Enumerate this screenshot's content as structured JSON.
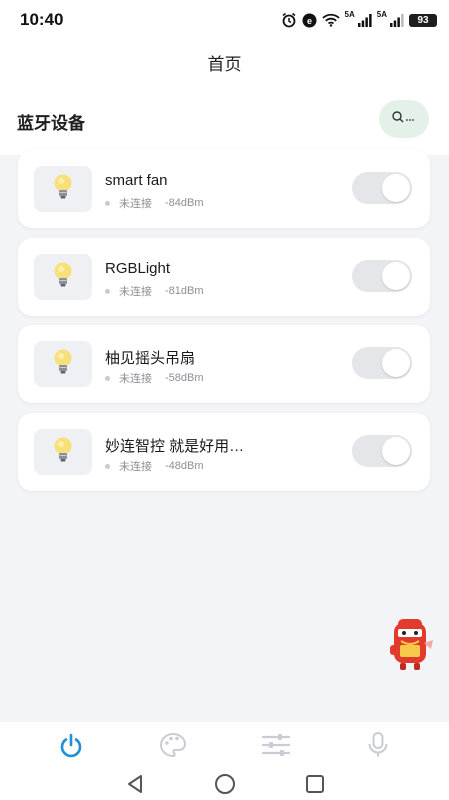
{
  "status_bar": {
    "time": "10:40",
    "network_label_1": "5A",
    "network_label_2": "5A",
    "battery": "93"
  },
  "header": {
    "title": "首页"
  },
  "section": {
    "title": "蓝牙设备",
    "scan_icon": "search-icon"
  },
  "devices": [
    {
      "name": "smart fan",
      "status": "未连接",
      "rssi": "-84dBm"
    },
    {
      "name": "RGBLight",
      "status": "未连接",
      "rssi": "-81dBm"
    },
    {
      "name": "柚见摇头吊扇",
      "status": "未连接",
      "rssi": "-58dBm"
    },
    {
      "name": "妙连智控 就是好用…",
      "status": "未连接",
      "rssi": "-48dBm"
    }
  ],
  "tabbar": {
    "tabs": [
      {
        "icon": "power-icon",
        "active": true
      },
      {
        "icon": "palette-icon",
        "active": false
      },
      {
        "icon": "sliders-icon",
        "active": false
      },
      {
        "icon": "microphone-icon",
        "active": false
      }
    ]
  },
  "colors": {
    "accent": "#1f8fd6",
    "inactive_icon": "#c9ccd3",
    "scan_button_bg": "#e3f1e9",
    "toggle_off": "#e4e6ea"
  }
}
